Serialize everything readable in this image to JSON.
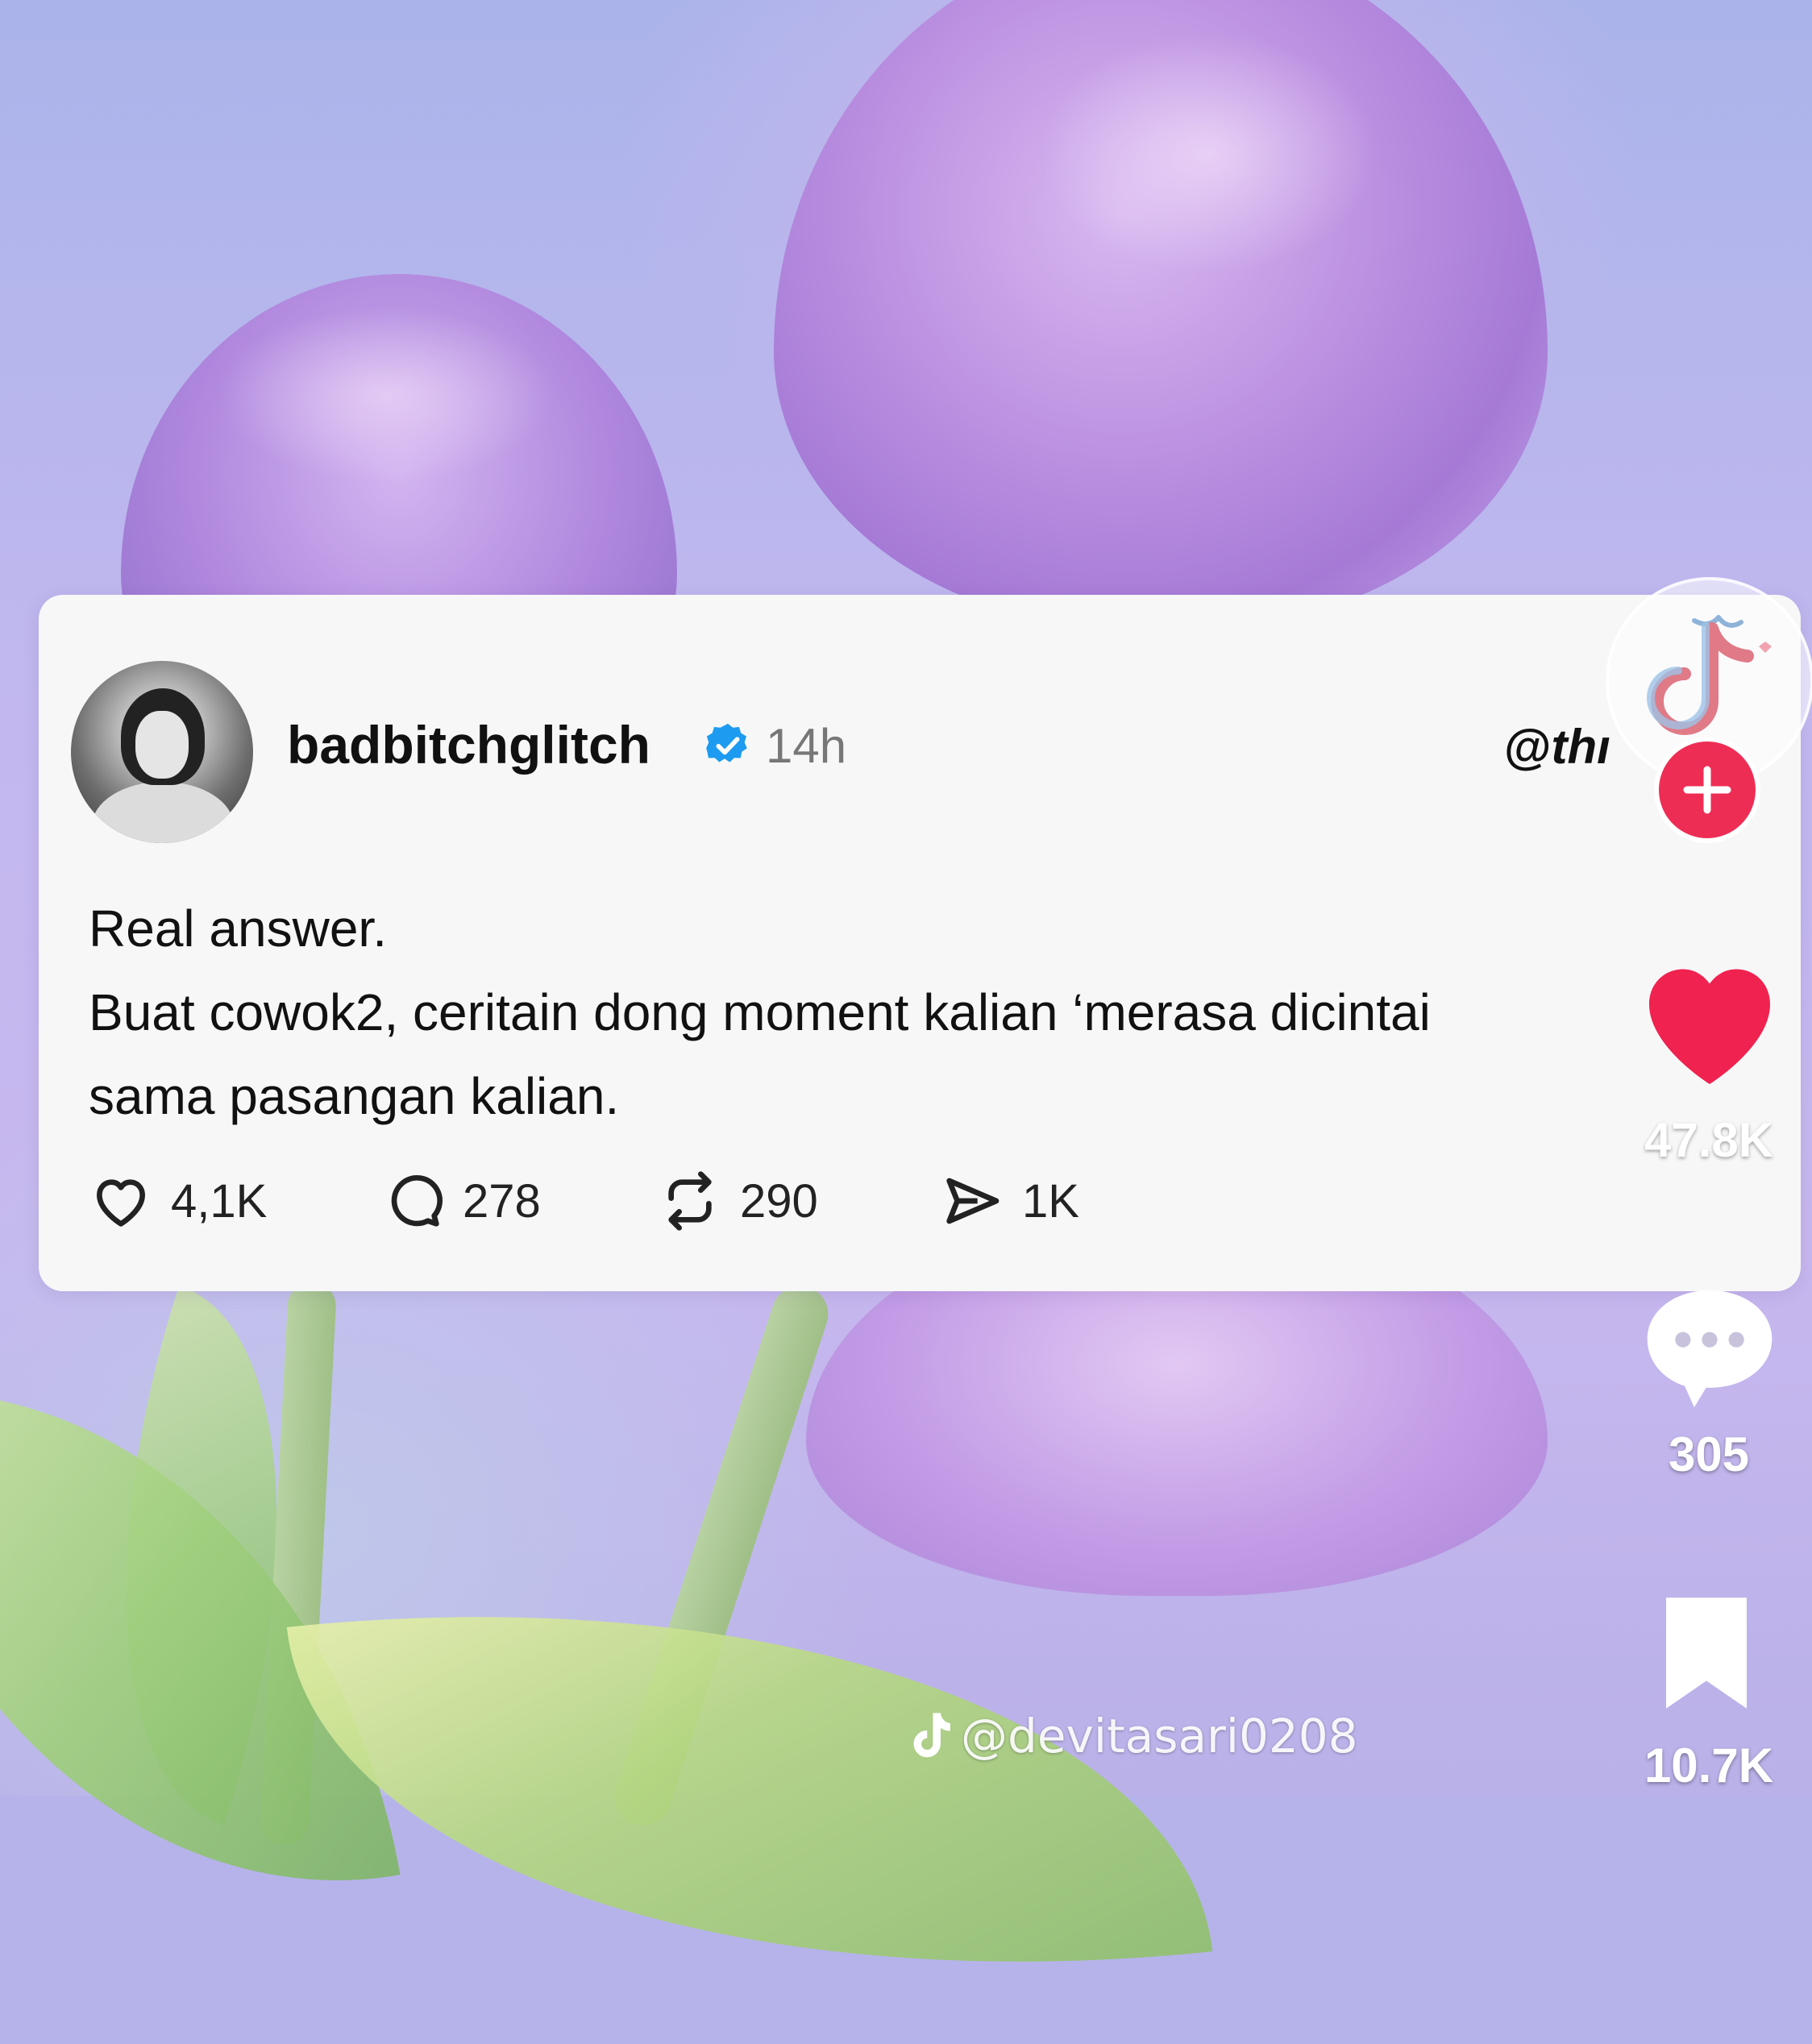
{
  "post": {
    "username": "badbitchglitch",
    "time": "14h",
    "threads_logo_text": "thı",
    "text_lines": [
      "Real answer.",
      "Buat cowok2, ceritain dong moment kalian ‘merasa dicintai",
      "sama pasangan kalian."
    ],
    "likes": "4,1K",
    "comments": "278",
    "reposts": "290",
    "shares": "1K"
  },
  "tiktok": {
    "like_count": "47.8K",
    "comment_count": "305",
    "bookmark_count": "10.7K",
    "watermark": "@devitasari0208"
  },
  "colors": {
    "verified": "#1d9bf0",
    "tiktok_red": "#ee2d55",
    "card_bg": "#f7f7f8"
  },
  "icons": {
    "verified": "verified-badge-icon",
    "like": "heart-outline-icon",
    "comment": "comment-bubble-icon",
    "repost": "repost-icon",
    "share": "send-icon",
    "follow": "plus-icon",
    "tiktok_like": "heart-filled-icon",
    "tiktok_comment": "comment-dots-icon",
    "tiktok_bookmark": "bookmark-icon",
    "watermark_logo": "tiktok-logo-icon"
  }
}
